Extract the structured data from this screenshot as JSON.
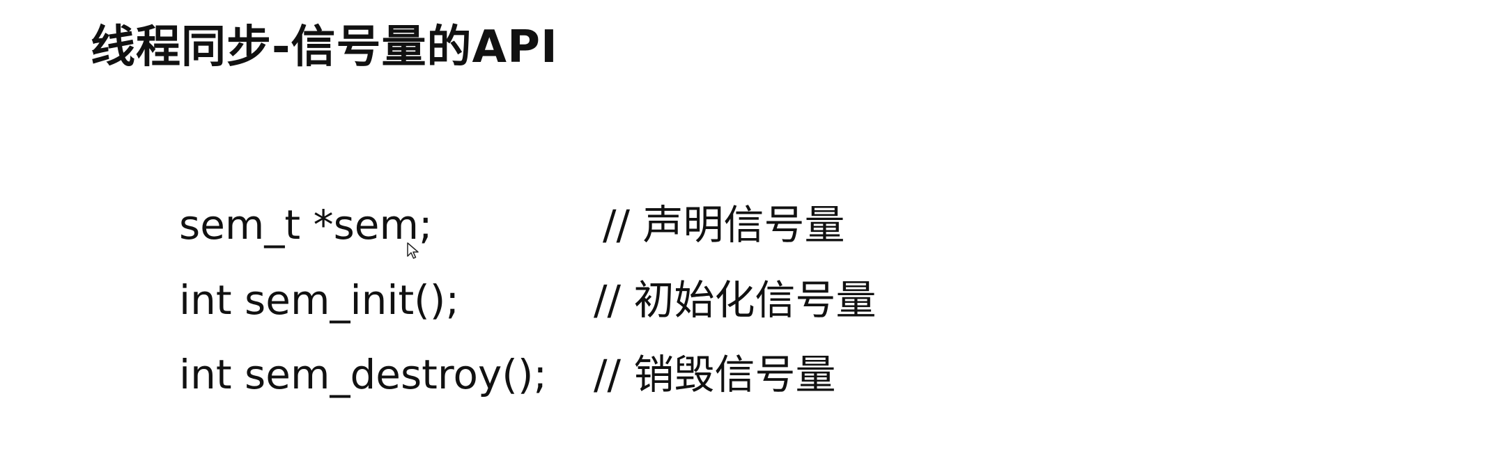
{
  "slide": {
    "title": "线程同步-信号量的API",
    "lines": [
      {
        "code": "sem_t *sem;",
        "comment": "// 声明信号量"
      },
      {
        "code": "int sem_init();",
        "comment": "// 初始化信号量"
      },
      {
        "code": "int sem_destroy();",
        "comment": "// 销毁信号量"
      }
    ]
  },
  "icons": {
    "cursor": "mouse-pointer-icon"
  },
  "colors": {
    "background": "#ffffff",
    "text": "#111111"
  }
}
